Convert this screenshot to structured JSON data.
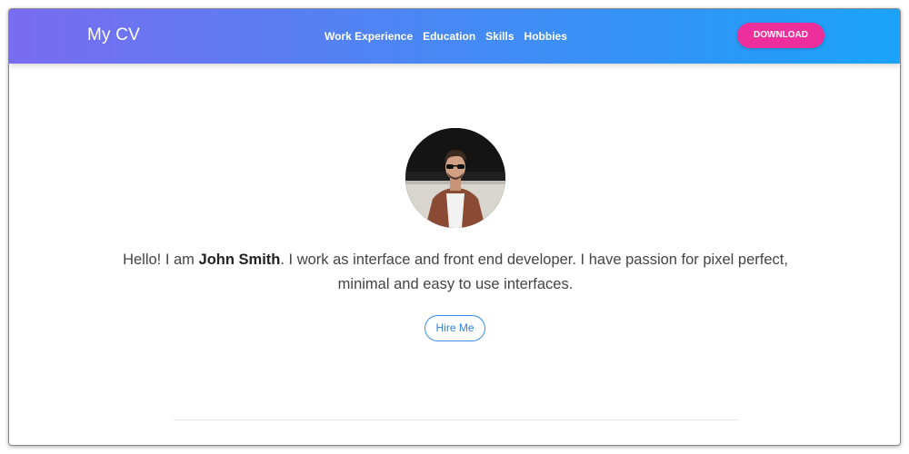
{
  "header": {
    "brand": "My CV",
    "nav": [
      {
        "label": "Work Experience"
      },
      {
        "label": "Education"
      },
      {
        "label": "Skills"
      },
      {
        "label": "Hobbies"
      }
    ],
    "download_label": "DOWNLOAD"
  },
  "hero": {
    "intro_before": "Hello! I am ",
    "name": "John Smith",
    "intro_after": ". I work as interface and front end developer. I have passion for pixel perfect, minimal and easy to use interfaces.",
    "hire_label": "Hire Me"
  },
  "colors": {
    "gradient_start": "#7a6cf0",
    "gradient_end": "#1aa3f8",
    "download_bg": "#ee2f9b",
    "hire_border": "#3b8fe8"
  },
  "icons": {
    "avatar": "profile-photo"
  }
}
